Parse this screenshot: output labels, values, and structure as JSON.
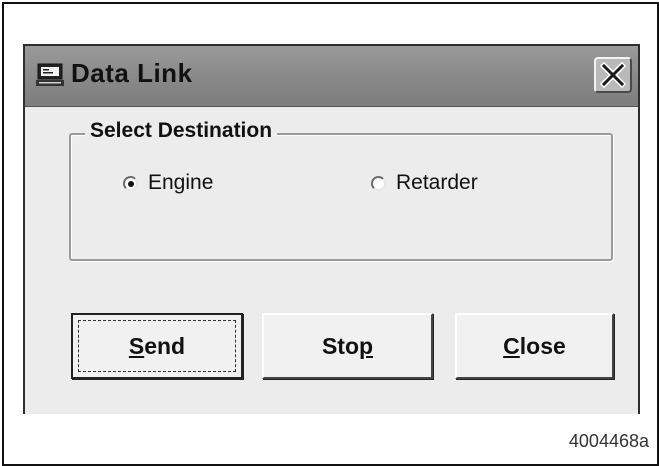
{
  "window": {
    "title": "Data Link",
    "close_icon": "close-x-icon"
  },
  "destination_group": {
    "legend": "Select Destination",
    "options": [
      {
        "label": "Engine",
        "selected": true
      },
      {
        "label": "Retarder",
        "selected": false
      }
    ]
  },
  "buttons": {
    "send": {
      "mnemonic": "S",
      "rest": "end"
    },
    "stop": {
      "main": "Sto",
      "mnemonic": "p"
    },
    "close": {
      "mnemonic": "C",
      "rest": "lose"
    }
  },
  "figure_code": "4004468a"
}
